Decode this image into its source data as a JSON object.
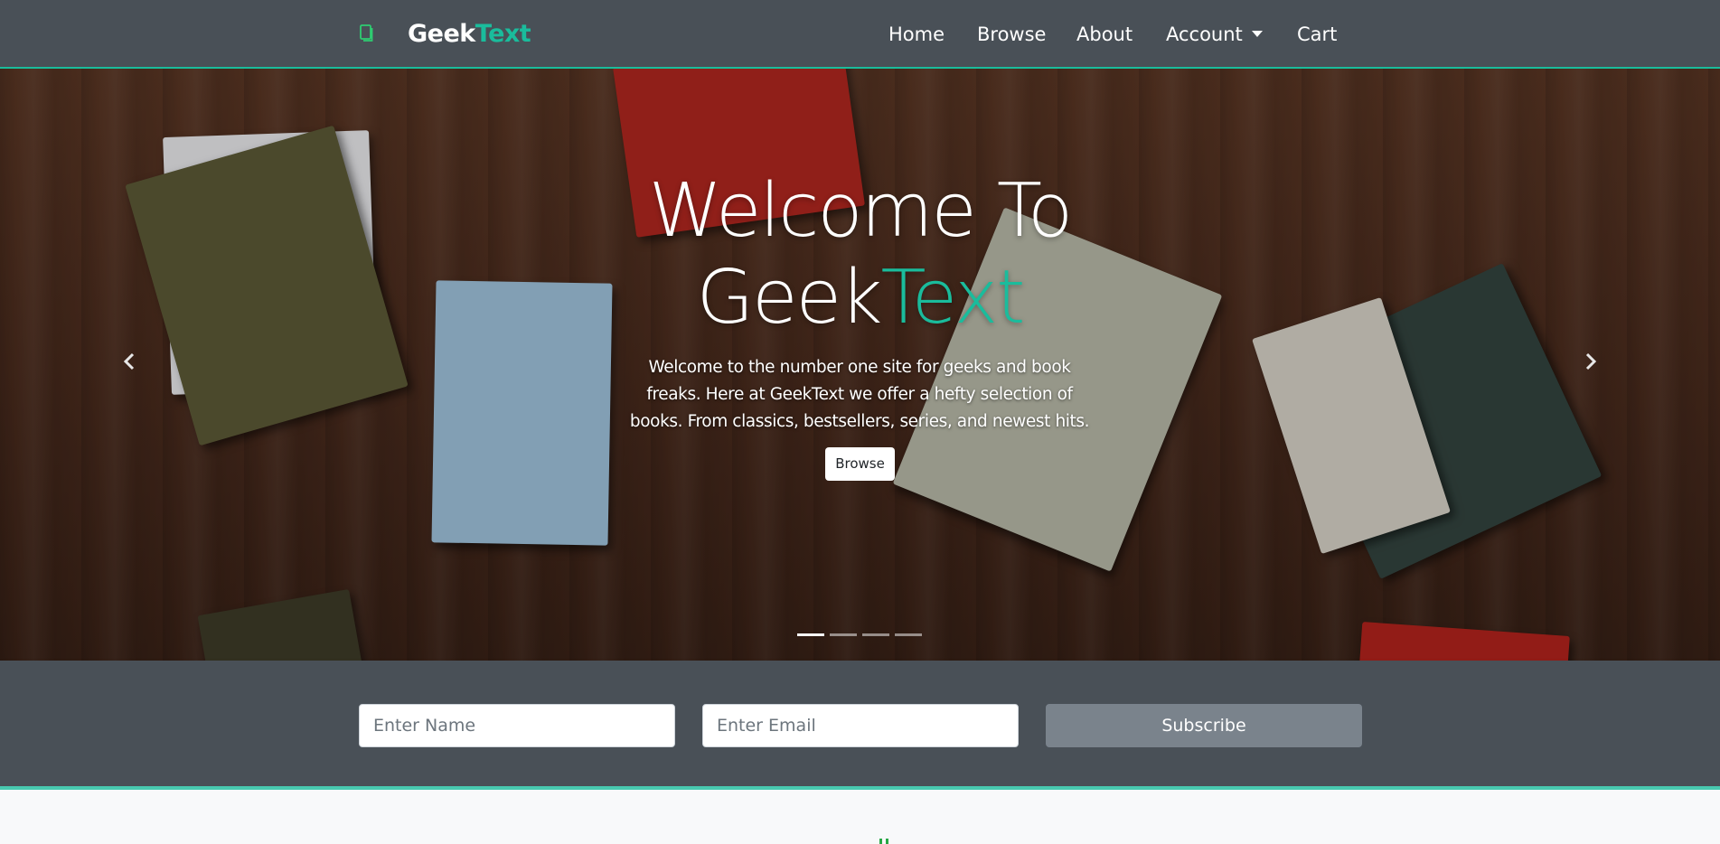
{
  "nav": {
    "brand_part1": "Geek",
    "brand_part2": "Text",
    "brand_icon": "book-icon",
    "links": [
      "Home",
      "Browse",
      "About",
      "Account",
      "Cart"
    ]
  },
  "hero": {
    "title_line1": "Welcome To",
    "title_part1": "Geek",
    "title_part2": "Text",
    "description": "Welcome to the number one site for geeks and book freaks. Here at GeekText we offer a hefty selection of books. From classics, bestsellers, series, and newest hits.",
    "button_label": "Browse",
    "prev_icon": "chevron-left-icon",
    "next_icon": "chevron-right-icon",
    "slide_count": 4,
    "active_slide": 1
  },
  "subscribe": {
    "name_placeholder": "Enter Name",
    "email_placeholder": "Enter Email",
    "button_label": "Subscribe"
  },
  "colors": {
    "accent": "#1abc9c",
    "navbar_bg": "#495057",
    "subscribe_button": "#7a838c"
  }
}
